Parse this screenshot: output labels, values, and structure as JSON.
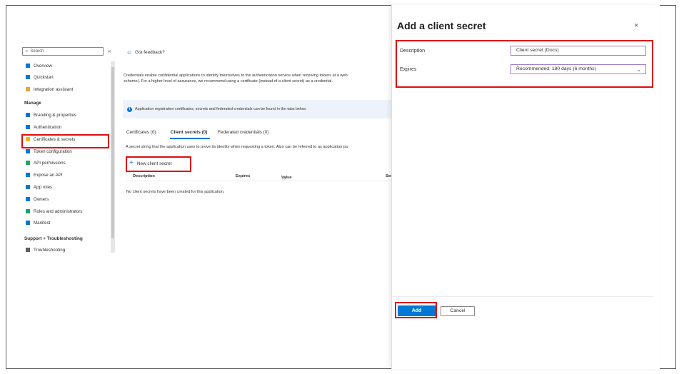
{
  "sidebar": {
    "search_placeholder": "Search",
    "collapse_glyph": "«",
    "items": [
      {
        "label": "Overview",
        "icon": "overview-icon",
        "color": "#0078d4"
      },
      {
        "label": "Quickstart",
        "icon": "quickstart-icon",
        "color": "#0078d4"
      },
      {
        "label": "Integration assistant",
        "icon": "rocket-icon",
        "color": "#e8a33d"
      }
    ],
    "manage_header": "Manage",
    "manage_items": [
      {
        "label": "Branding & properties",
        "icon": "branding-icon",
        "color": "#0078d4"
      },
      {
        "label": "Authentication",
        "icon": "authentication-icon",
        "color": "#0078d4"
      },
      {
        "label": "Certificates & secrets",
        "icon": "key-icon",
        "color": "#f2b600"
      },
      {
        "label": "Token configuration",
        "icon": "token-icon",
        "color": "#0078d4"
      },
      {
        "label": "API permissions",
        "icon": "permissions-icon",
        "color": "#21a366"
      },
      {
        "label": "Expose an API",
        "icon": "cloud-icon",
        "color": "#0078d4"
      },
      {
        "label": "App roles",
        "icon": "app-roles-icon",
        "color": "#0078d4"
      },
      {
        "label": "Owners",
        "icon": "owners-icon",
        "color": "#0078d4"
      },
      {
        "label": "Roles and administrators",
        "icon": "roles-icon",
        "color": "#21a366"
      },
      {
        "label": "Manifest",
        "icon": "manifest-icon",
        "color": "#0078d4"
      }
    ],
    "support_header": "Support + Troubleshooting",
    "support_items": [
      {
        "label": "Troubleshooting",
        "icon": "wrench-icon",
        "color": "#605e5c"
      }
    ]
  },
  "main": {
    "feedback_label": "Got feedback?",
    "description_line1": "Credentials enable confidential applications to identify themselves to the authentication service when receiving tokens at a web",
    "description_line2": "scheme). For a higher level of assurance, we recommend using a certificate (instead of a client secret) as a credential.",
    "info_text": "Application registration certificates, secrets and federated credentials can be found in the tabs below.",
    "tabs": [
      "Certificates (0)",
      "Client secrets (0)",
      "Federated credentials (0)"
    ],
    "secret_desc": "A secret string that the application uses to prove its identity when requesting a token. Also can be referred to as application pa",
    "new_secret_label": "New client secret",
    "columns": [
      "Description",
      "Expires",
      "Value",
      "Sec"
    ],
    "empty_text": "No client secrets have been created for this application."
  },
  "panel": {
    "title": "Add a client secret",
    "close_glyph": "×",
    "description_label": "Description",
    "description_value": "Client secret (Docs)",
    "expires_label": "Expires",
    "expires_value": "Recommended: 180 days (6 months)",
    "add_label": "Add",
    "cancel_label": "Cancel"
  },
  "colors": {
    "accent": "#0078d4",
    "highlight": "#e00d0d",
    "info_bg": "#eef3fb"
  }
}
